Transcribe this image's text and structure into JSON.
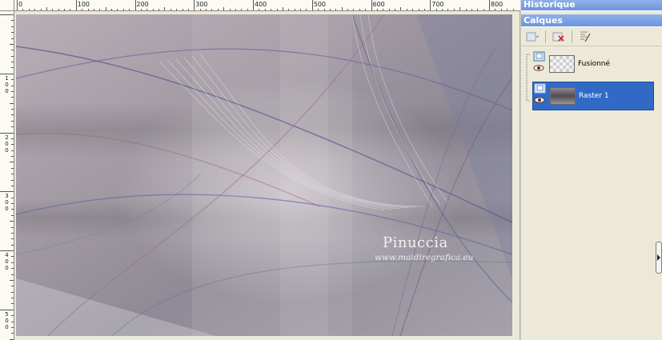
{
  "ruler": {
    "top_labels": [
      "0",
      "100",
      "200",
      "300",
      "400",
      "500",
      "600",
      "700",
      "800"
    ],
    "left_labels": [
      [
        "1",
        "0",
        "0"
      ],
      [
        "2",
        "0",
        "0"
      ],
      [
        "3",
        "0",
        "0"
      ],
      [
        "4",
        "0",
        "0"
      ],
      [
        "5",
        "0",
        "0"
      ]
    ]
  },
  "canvas": {
    "watermark_title": "Pinuccia",
    "watermark_url": "www.maidiregrafica.eu"
  },
  "panels": {
    "history_title": "Historique",
    "layers_title": "Calques",
    "toolbar_icons": [
      "new-layer-icon",
      "delete-layer-icon",
      "layer-properties-icon"
    ],
    "layers": [
      {
        "name": "Fusionné",
        "selected": false,
        "visible": true
      },
      {
        "name": "Raster 1",
        "selected": true,
        "visible": true
      }
    ]
  },
  "colors": {
    "title_bar": "#6c94de",
    "selection": "#316ac5",
    "panel_bg": "#ece9d8"
  }
}
